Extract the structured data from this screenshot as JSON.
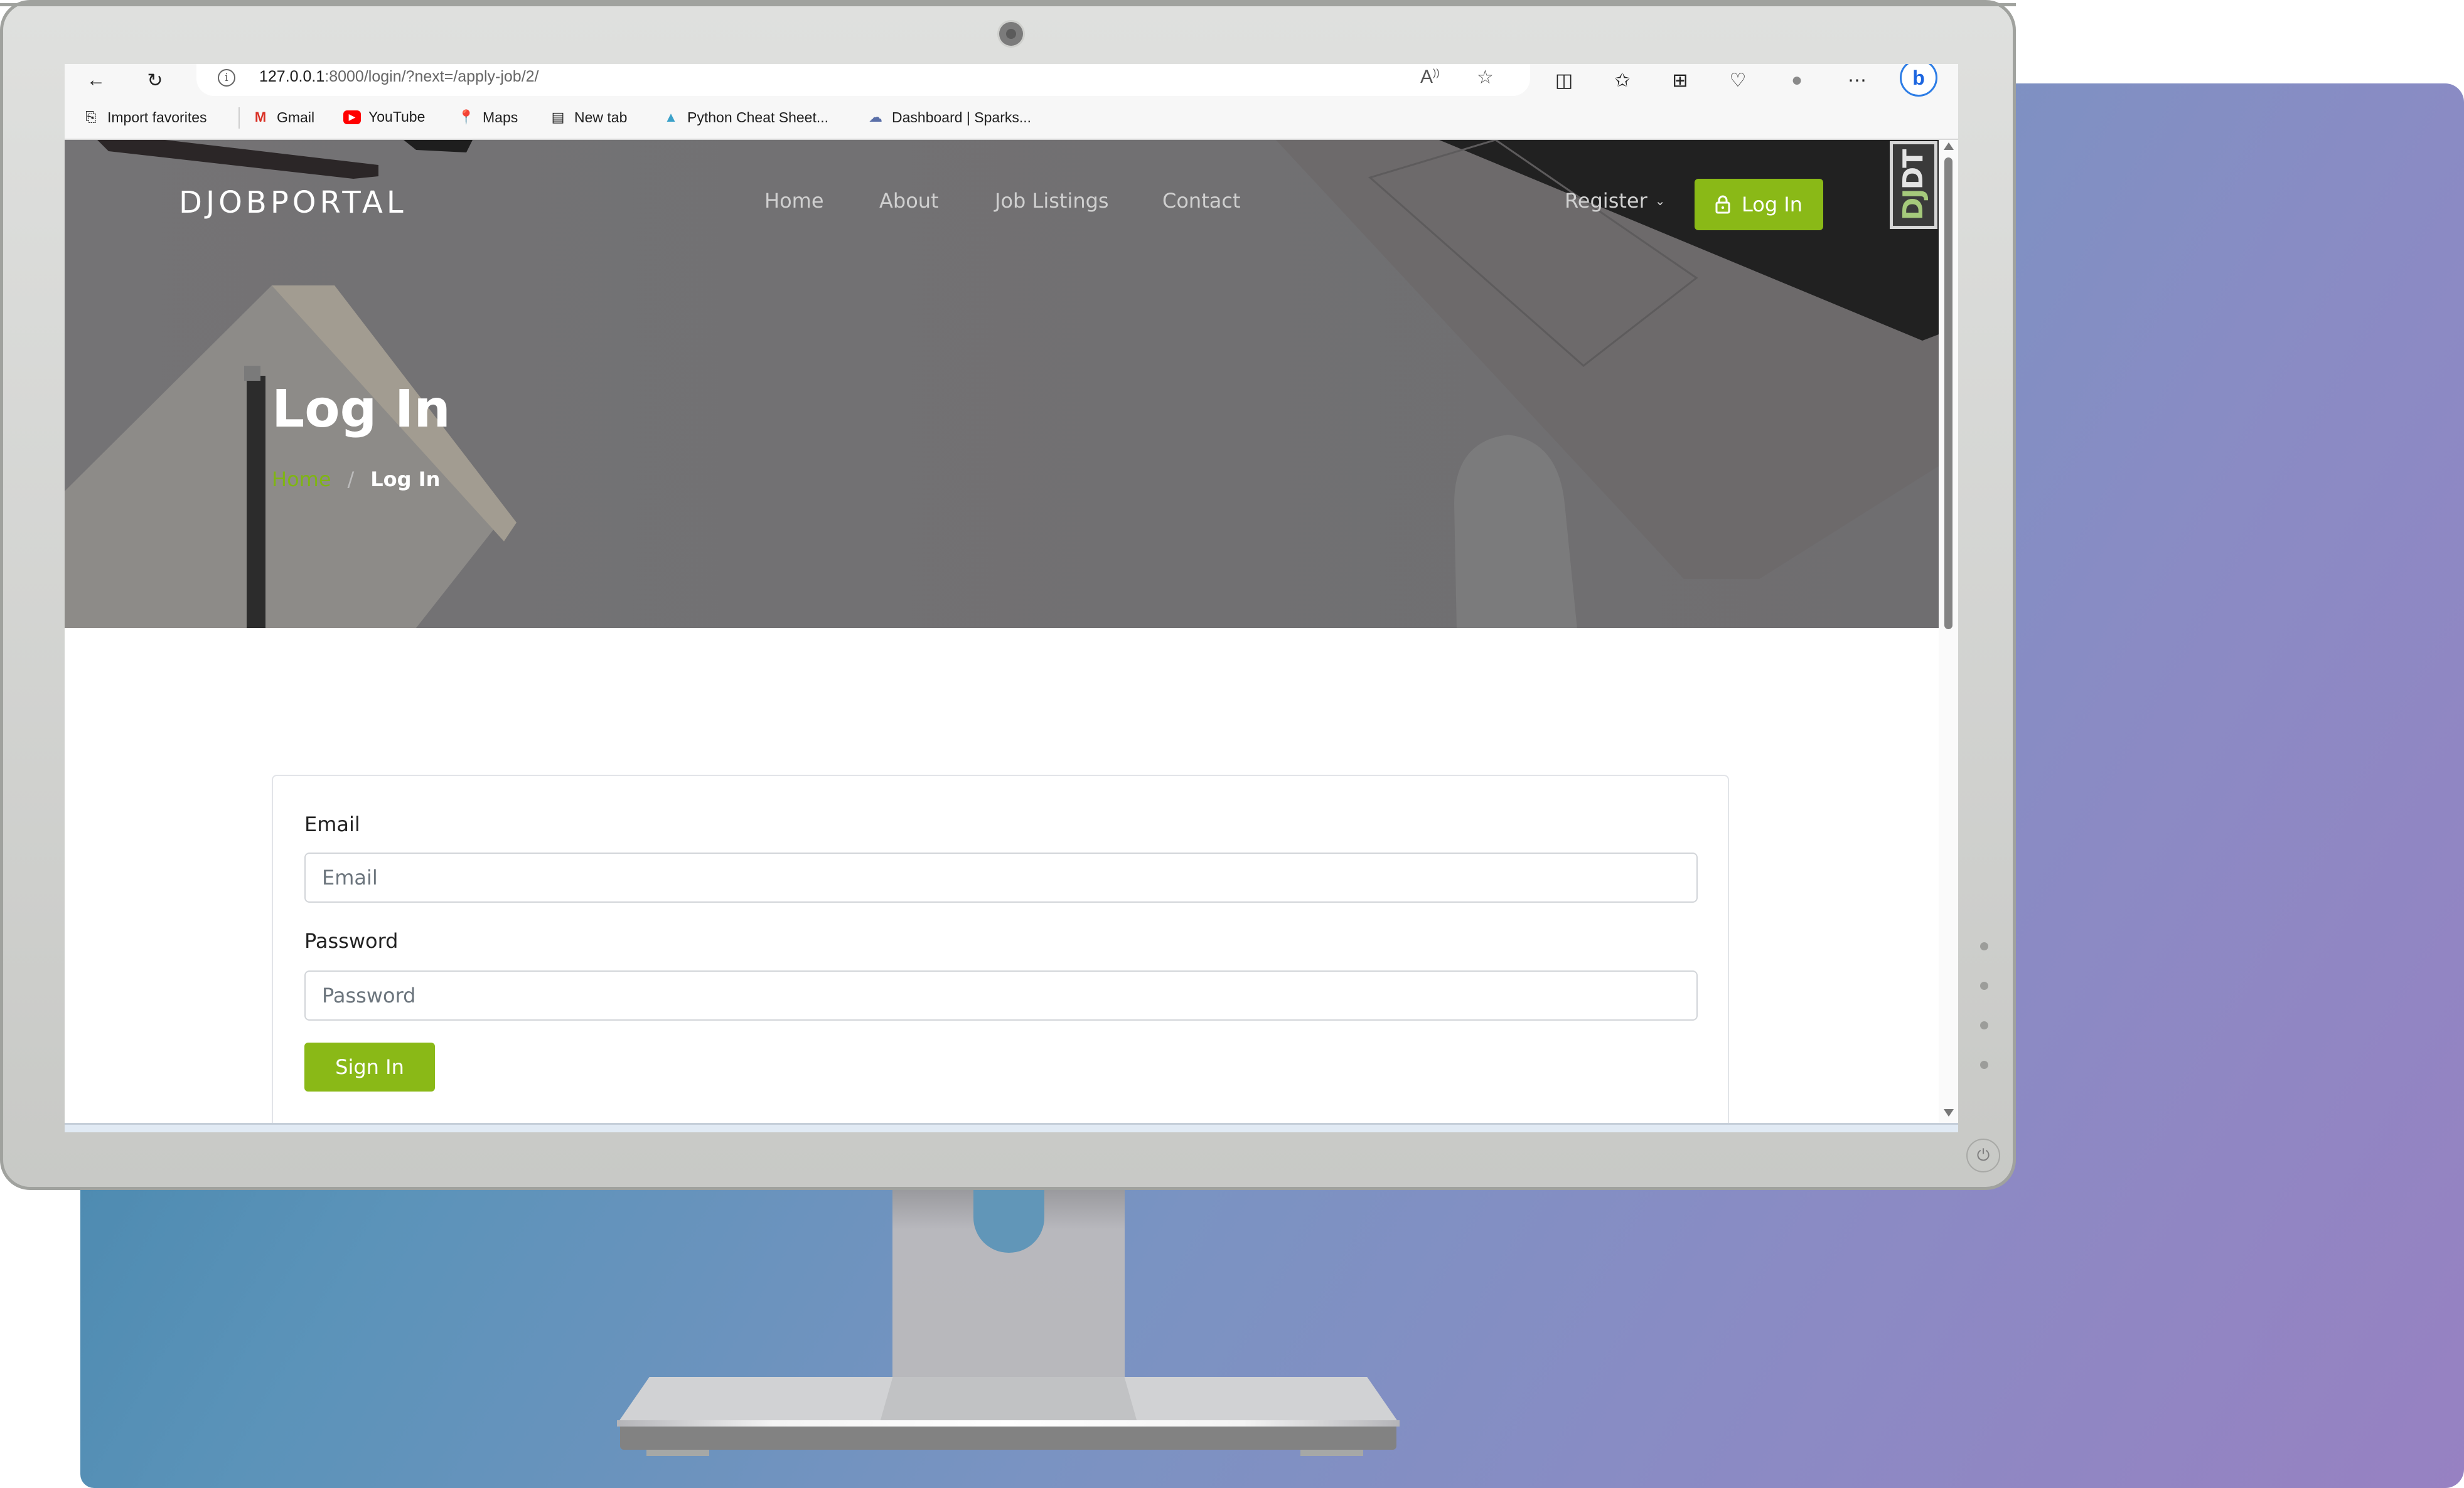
{
  "browser": {
    "url_host": "127.0.0.1",
    "url_port_path": ":8000/login/?next=/apply-job/2/",
    "toolbar_icons": [
      "back-icon",
      "refresh-icon",
      "site-info-icon",
      "read-aloud-icon",
      "favorite-star-icon",
      "split-screen-icon",
      "favorites-list-icon",
      "collections-icon",
      "browser-essentials-icon",
      "profile-icon",
      "more-menu-icon",
      "bing-copilot-icon"
    ],
    "bookmarks": [
      {
        "label": "Import favorites",
        "icon": "import-favorites-icon"
      },
      {
        "label": "Gmail",
        "icon": "gmail-icon"
      },
      {
        "label": "YouTube",
        "icon": "youtube-icon"
      },
      {
        "label": "Maps",
        "icon": "maps-icon"
      },
      {
        "label": "New tab",
        "icon": "new-tab-icon"
      },
      {
        "label": "Python Cheat Sheet...",
        "icon": "python-cheat-sheet-icon"
      },
      {
        "label": "Dashboard | Sparks...",
        "icon": "dashboard-icon"
      }
    ]
  },
  "site": {
    "logo": "DJOBPORTAL",
    "nav": [
      {
        "label": "Home"
      },
      {
        "label": "About"
      },
      {
        "label": "Job Listings"
      },
      {
        "label": "Contact"
      }
    ],
    "register_label": "Register",
    "login_button_label": "Log In",
    "debug_toolbar_label_a": "DJ",
    "debug_toolbar_label_b": "DT",
    "accent_color": "#8ab917"
  },
  "hero": {
    "title": "Log In",
    "breadcrumb": {
      "home": "Home",
      "separator": "/",
      "current": "Log In"
    }
  },
  "form": {
    "email_label": "Email",
    "email_placeholder": "Email",
    "email_value": "",
    "password_label": "Password",
    "password_placeholder": "Password",
    "password_value": "",
    "submit_label": "Sign In"
  }
}
